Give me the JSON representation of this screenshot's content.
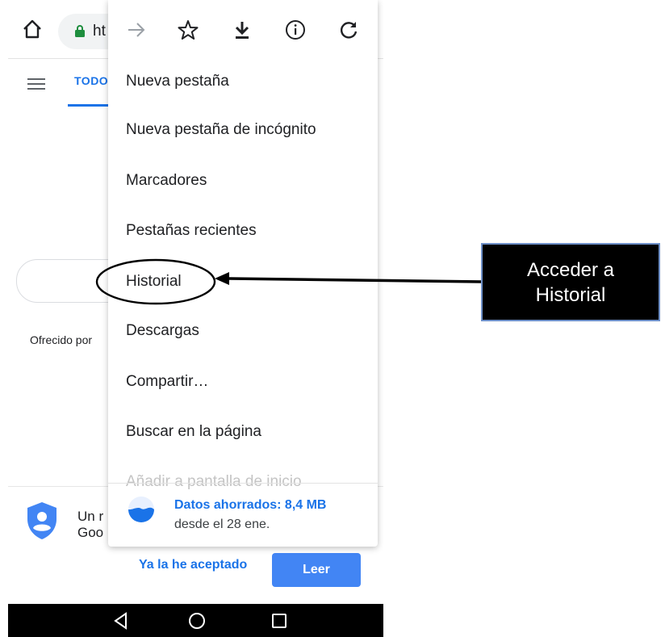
{
  "toolbar": {
    "url_text": "ht"
  },
  "tabs": {
    "todo": "TODO"
  },
  "page": {
    "offered_by": "Ofrecido por"
  },
  "menu": {
    "items": [
      "Nueva pestaña",
      "Nueva pestaña de incógnito",
      "Marcadores",
      "Pestañas recientes",
      "Historial",
      "Descargas",
      "Compartir…",
      "Buscar en la página",
      "Añadir a pantalla de inicio"
    ],
    "data_saver": {
      "title": "Datos ahorrados: 8,4 MB",
      "subtitle": "desde el 28 ene."
    }
  },
  "consent": {
    "line1": "Un r",
    "line2": "Goo",
    "accept_label": "Ya la he aceptado",
    "read_label": "Leer"
  },
  "callout": {
    "line1": "Acceder a",
    "line2": "Historial"
  },
  "icons": [
    "home-icon",
    "lock-icon",
    "forward-icon",
    "star-icon",
    "download-icon",
    "info-icon",
    "reload-icon",
    "hamburger-icon",
    "shield-icon",
    "data-saver-icon",
    "back-icon",
    "circle-home-icon",
    "recents-icon"
  ],
  "colors": {
    "accent": "#1a73e8",
    "button": "#4285f4",
    "secure": "#1e8e3e"
  }
}
